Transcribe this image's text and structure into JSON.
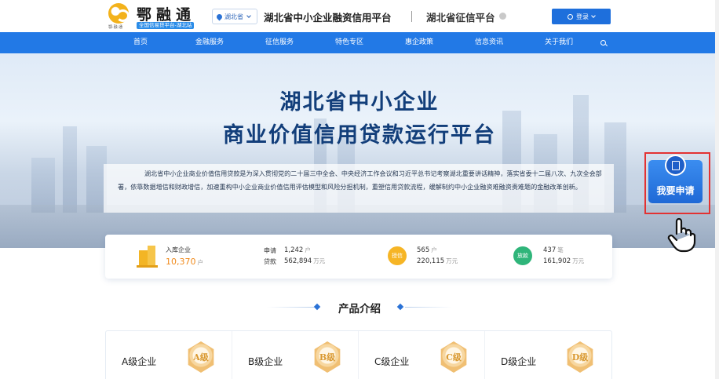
{
  "header": {
    "logo_title": "鄂融通",
    "logo_mark_sub": "鄂·融·通",
    "logo_sub": "全国信易贷平台-湖北站",
    "region": "湖北省",
    "platform_title": "湖北省中小企业融资信用平台",
    "credit_title": "湖北省征信平台",
    "login_label": "登录"
  },
  "nav": {
    "items": [
      "首页",
      "金融服务",
      "征信服务",
      "特色专区",
      "惠企政策",
      "信息资讯",
      "关于我们"
    ]
  },
  "hero": {
    "title_line1": "湖北省中小企业",
    "title_line2": "商业价值信用贷款运行平台",
    "description": "湖北省中小企业商业价值信用贷款是为深入贯彻党的二十届三中全会、中央经济工作会议和习近平总书记考察湖北重要讲话精神，落实省委十二届八次、九次全会部署，依靠数据增信和财政增信，加速重构中小企业商业价值信用评估模型和风险分担机制，重塑信用贷款流程，缓解制约中小企业融资难融资贵难题的金融改革创新。"
  },
  "stats": {
    "enterprise_label": "入库企业",
    "enterprise_value": "10,370",
    "enterprise_unit": "户",
    "apply_label": "申请",
    "apply_value": "1,242",
    "apply_unit": "户",
    "loan_label": "贷款",
    "loan_value": "562,894",
    "loan_unit": "万元",
    "credit_badge": "授信",
    "credit_count": "565",
    "credit_count_unit": "户",
    "credit_amount": "220,115",
    "credit_amount_unit": "万元",
    "release_badge": "放款",
    "release_count": "437",
    "release_count_unit": "笔",
    "release_amount": "161,902",
    "release_amount_unit": "万元"
  },
  "products": {
    "title": "产品介绍",
    "items": [
      {
        "name": "A级企业",
        "grade": "A级"
      },
      {
        "name": "B级企业",
        "grade": "B级"
      },
      {
        "name": "C级企业",
        "grade": "C级"
      },
      {
        "name": "D级企业",
        "grade": "D级"
      }
    ]
  },
  "floating": {
    "apply_label": "我要申请"
  },
  "colors": {
    "brand_blue": "#2279e6",
    "accent_orange": "#f08a1c",
    "highlight_red": "#e33232"
  }
}
